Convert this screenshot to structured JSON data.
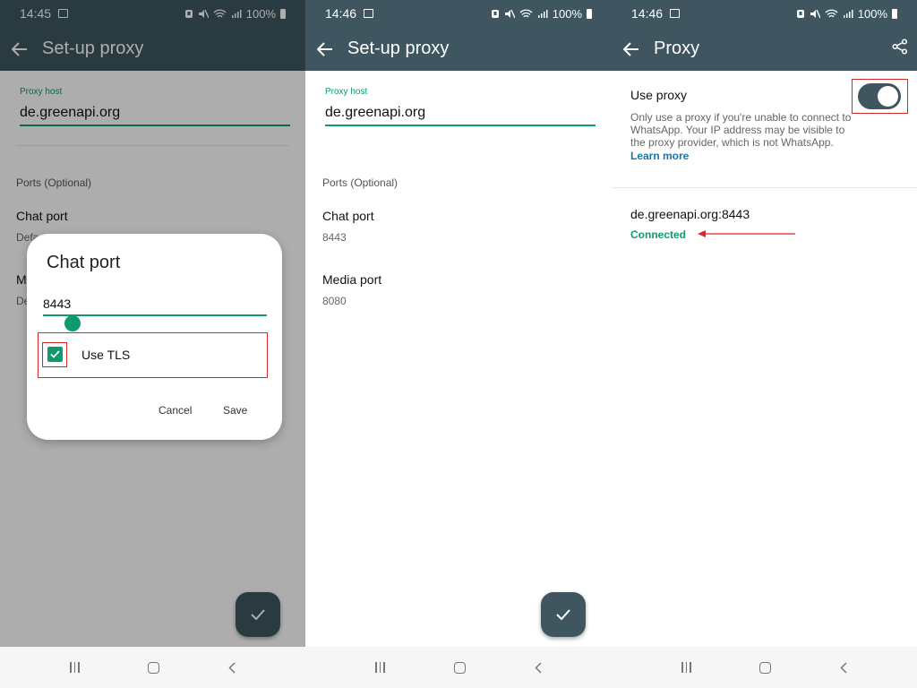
{
  "panels": [
    {
      "status": {
        "time": "14:45",
        "battery": "100%"
      },
      "title": "Set-up proxy",
      "proxy_host_label": "Proxy host",
      "proxy_host_value": "de.greenapi.org",
      "ports_label": "Ports (Optional)",
      "chat_port_title": "Chat port",
      "chat_port_sub": "Defa",
      "media_port_title": "M",
      "media_port_sub": "De",
      "dialog": {
        "title": "Chat port",
        "input_value": "8443",
        "checkbox_label": "Use TLS",
        "checkbox_checked": true,
        "cancel_label": "Cancel",
        "save_label": "Save"
      },
      "fab_icon": "check-icon"
    },
    {
      "status": {
        "time": "14:46",
        "battery": "100%"
      },
      "title": "Set-up proxy",
      "proxy_host_label": "Proxy host",
      "proxy_host_value": "de.greenapi.org",
      "ports_label": "Ports (Optional)",
      "chat_port_title": "Chat port",
      "chat_port_value": "8443",
      "media_port_title": "Media port",
      "media_port_value": "8080",
      "fab_icon": "check-icon"
    },
    {
      "status": {
        "time": "14:46",
        "battery": "100%"
      },
      "title": "Proxy",
      "use_proxy_label": "Use proxy",
      "use_proxy_enabled": true,
      "description": "Only use a proxy if you're unable to connect to WhatsApp. Your IP address may be visible to the proxy provider, which is not WhatsApp.",
      "learn_more": "Learn more",
      "proxy_address": "de.greenapi.org:8443",
      "proxy_status": "Connected"
    }
  ],
  "colors": {
    "appbar": "#3f5660",
    "accent": "#0d9a6f",
    "highlight": "#d62828",
    "link": "#1976a8"
  }
}
